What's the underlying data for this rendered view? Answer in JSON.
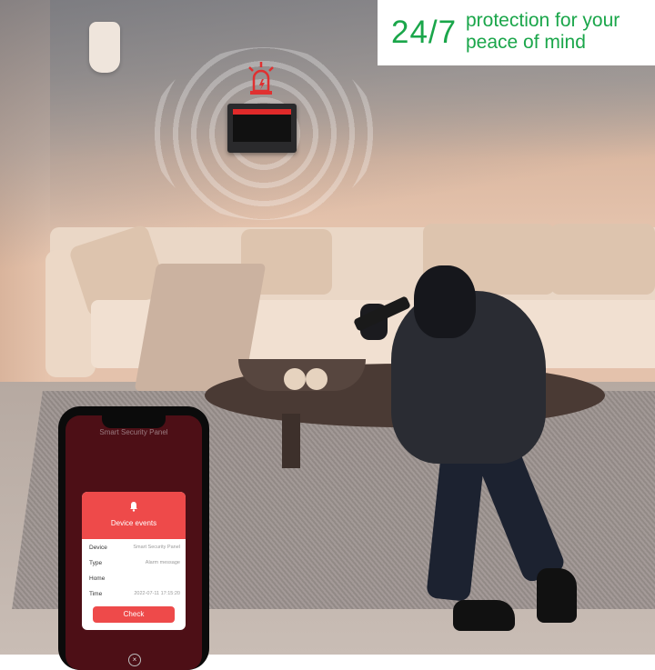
{
  "banner": {
    "headline": "24/7",
    "tagline": "protection for your peace of mind"
  },
  "phone": {
    "app_title": "Smart Security Panel",
    "dialog": {
      "title": "Device events",
      "rows": [
        {
          "key": "Device",
          "value": "Smart Security Panel"
        },
        {
          "key": "Type",
          "value": "Alarm message"
        },
        {
          "key": "Home",
          "value": ""
        },
        {
          "key": "Time",
          "value": "2022-07-11 17:15:20"
        }
      ],
      "button": "Check"
    },
    "close_glyph": "×"
  },
  "colors": {
    "brand_green": "#1aa64a",
    "alert_red": "#ee4a4a"
  }
}
